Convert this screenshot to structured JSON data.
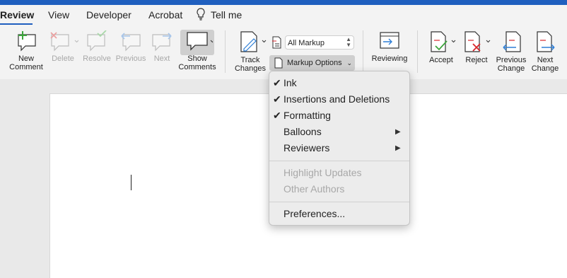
{
  "tabs": [
    {
      "label": "Review",
      "active": true
    },
    {
      "label": "Developer",
      "active": false
    },
    {
      "label": "Acrobat",
      "active": false
    },
    {
      "label": "Tell me",
      "active": false
    }
  ],
  "tab_view": "View",
  "ribbon": {
    "new_comment": "New\nComment",
    "delete": "Delete",
    "resolve": "Resolve",
    "previous": "Previous",
    "next": "Next",
    "show_comments": "Show\nComments",
    "track_changes": "Track\nChanges",
    "markup_select": "All Markup",
    "markup_options": "Markup Options",
    "reviewing": "Reviewing",
    "accept": "Accept",
    "reject": "Reject",
    "previous_change": "Previous\nChange",
    "next_change": "Next\nChange"
  },
  "menu": {
    "items": [
      {
        "label": "Ink",
        "checked": true
      },
      {
        "label": "Insertions and Deletions",
        "checked": true
      },
      {
        "label": "Formatting",
        "checked": true
      },
      {
        "label": "Balloons",
        "submenu": true
      },
      {
        "label": "Reviewers",
        "submenu": true
      },
      {
        "label": "Highlight Updates",
        "disabled": true
      },
      {
        "label": "Other Authors",
        "disabled": true
      },
      {
        "label": "Preferences..."
      }
    ]
  },
  "colors": {
    "accent": "#1f5fbf",
    "add": "#3ca53c",
    "remove": "#d9262b",
    "change": "#2f7fd6"
  },
  "icons": [
    "lightbulb-icon",
    "new-comment-icon",
    "delete-comment-icon",
    "resolve-comment-icon",
    "previous-comment-icon",
    "next-comment-icon",
    "show-comments-icon",
    "track-changes-icon",
    "markup-icon",
    "document-icon",
    "reviewing-pane-icon",
    "accept-icon",
    "reject-icon",
    "previous-change-icon",
    "next-change-icon",
    "checkmark-icon",
    "submenu-arrow-icon",
    "chevron-down-icon"
  ]
}
